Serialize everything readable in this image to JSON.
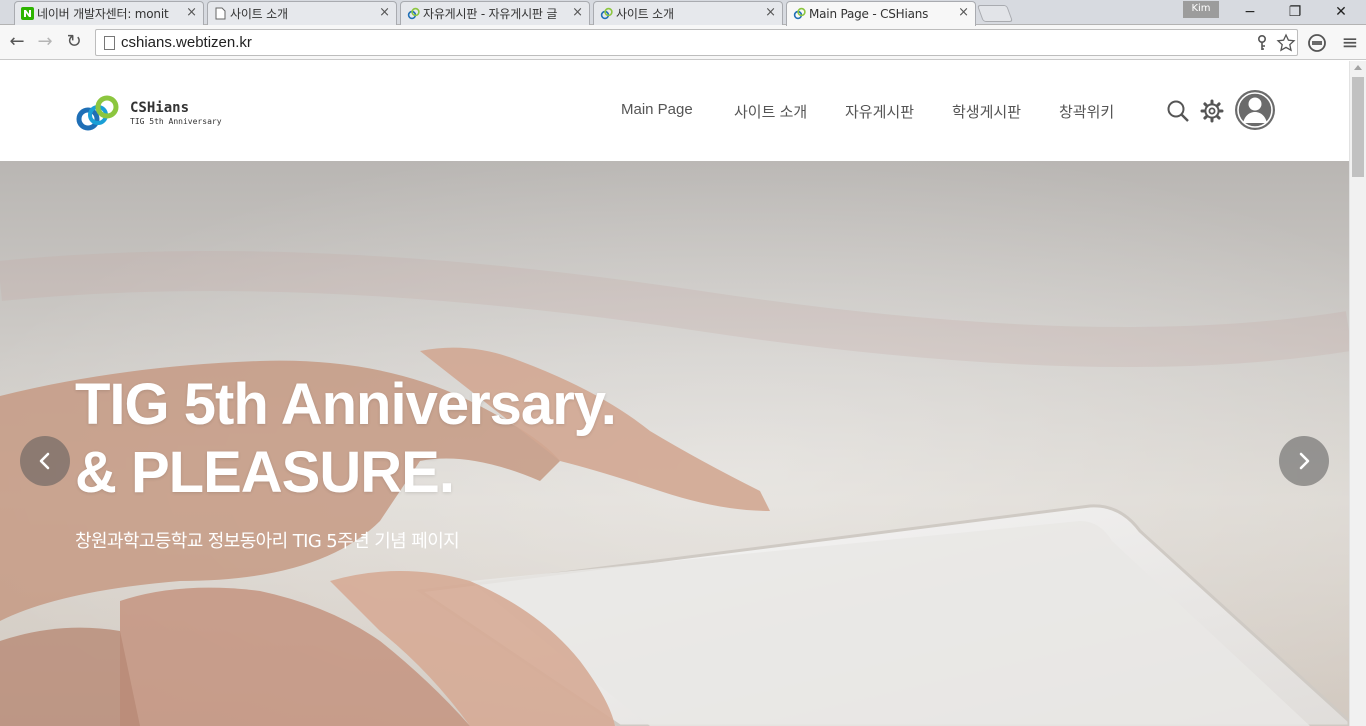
{
  "browser": {
    "tabs": [
      {
        "title": "네이버 개발자센터: monit",
        "icon": "naver-n-icon"
      },
      {
        "title": "사이트 소개",
        "icon": "page-icon"
      },
      {
        "title": "자유게시판 - 자유게시판 글",
        "icon": "cshians-logo-icon"
      },
      {
        "title": "사이트 소개",
        "icon": "cshians-logo-icon"
      },
      {
        "title": "Main Page - CSHians",
        "icon": "cshians-logo-icon",
        "active": true
      }
    ],
    "tab_close": "×",
    "profile_name": "Kim",
    "window_buttons": {
      "minimize": "−",
      "restore": "❐",
      "close": "✕"
    },
    "nav": {
      "back": "←",
      "forward": "→",
      "reload": "↻",
      "menu": "≡"
    },
    "url": "cshians.webtizen.kr"
  },
  "site": {
    "logo": {
      "name": "CSHians",
      "subtitle": "TIG 5th Anniversary"
    },
    "menu": [
      "Main Page",
      "사이트 소개",
      "자유게시판",
      "학생게시판",
      "창곽위키"
    ],
    "icons": [
      "search-icon",
      "gear-icon",
      "user-avatar-icon"
    ]
  },
  "hero": {
    "title_line1": "TIG 5th Anniversary.",
    "title_line2": "& PLEASURE.",
    "subtitle": "창원과학고등학교 정보동아리 TIG 5주년 기념 페이지",
    "prev_arrow": "‹",
    "next_arrow": "›"
  },
  "colors": {
    "logo_green": "#8cc63f",
    "logo_blue": "#1f6fb6",
    "menu_text": "#555555",
    "hero_text": "#ffffff"
  }
}
